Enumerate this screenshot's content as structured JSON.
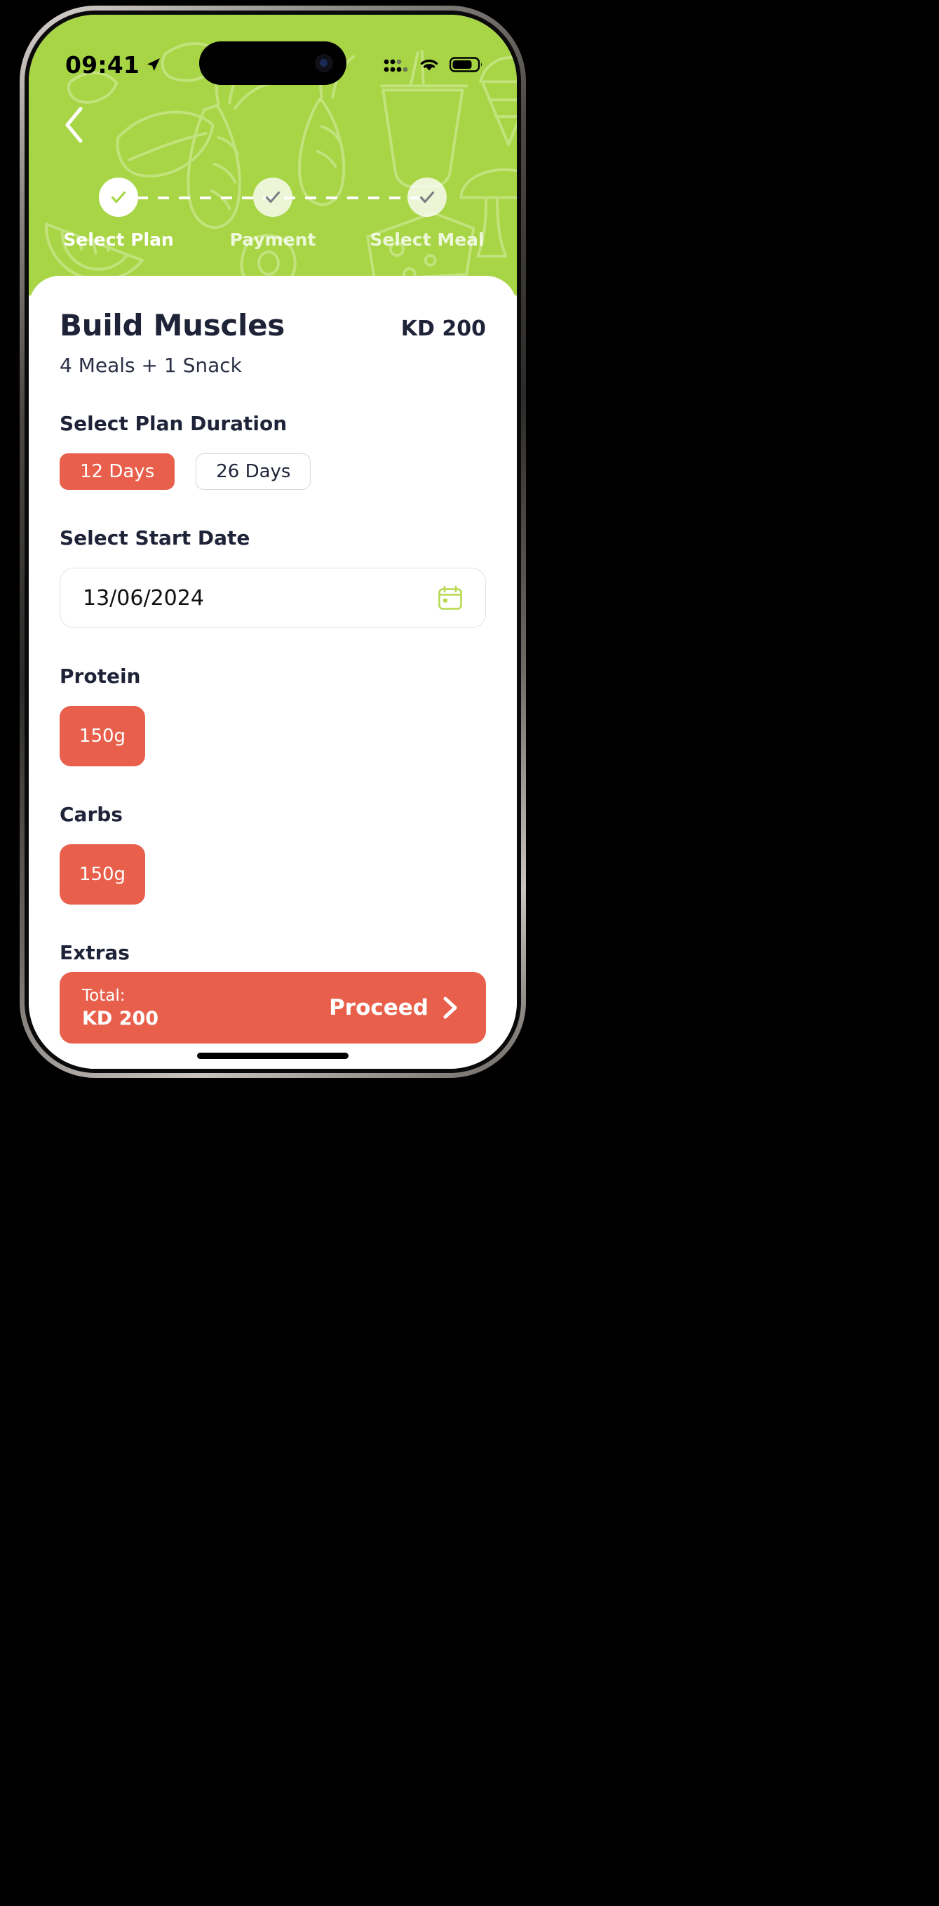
{
  "status_bar": {
    "time": "09:41",
    "location_icon": "location-arrow-icon",
    "cellular_icon": "cellular-bars-icon",
    "wifi_icon": "wifi-icon",
    "battery_icon": "battery-icon"
  },
  "header": {
    "back_icon": "chevron-left-icon",
    "background_color": "#a7d545",
    "stepper": {
      "steps": [
        {
          "label": "Select Plan",
          "state": "active",
          "icon": "check-icon"
        },
        {
          "label": "Payment",
          "state": "idle",
          "icon": "check-icon"
        },
        {
          "label": "Select Meal",
          "state": "idle",
          "icon": "check-icon"
        }
      ]
    }
  },
  "main": {
    "plan_title": "Build Muscles",
    "plan_price": "KD 200",
    "plan_subtitle": "4 Meals + 1 Snack",
    "duration": {
      "section_title": "Select Plan Duration",
      "options": [
        {
          "label": "12 Days",
          "selected": true
        },
        {
          "label": "26 Days",
          "selected": false
        }
      ]
    },
    "start_date": {
      "section_title": "Select Start Date",
      "value": "13/06/2024",
      "calendar_icon": "calendar-icon"
    },
    "protein": {
      "section_title": "Protein",
      "options": [
        {
          "label": "150g",
          "selected": true
        }
      ]
    },
    "carbs": {
      "section_title": "Carbs",
      "options": [
        {
          "label": "150g",
          "selected": true
        }
      ]
    },
    "extras": {
      "section_title": "Extras"
    }
  },
  "bottom_bar": {
    "total_label": "Total:",
    "total_value": "KD 200",
    "proceed_label": "Proceed",
    "proceed_icon": "chevron-right-icon",
    "accent_color": "#e8604c"
  }
}
